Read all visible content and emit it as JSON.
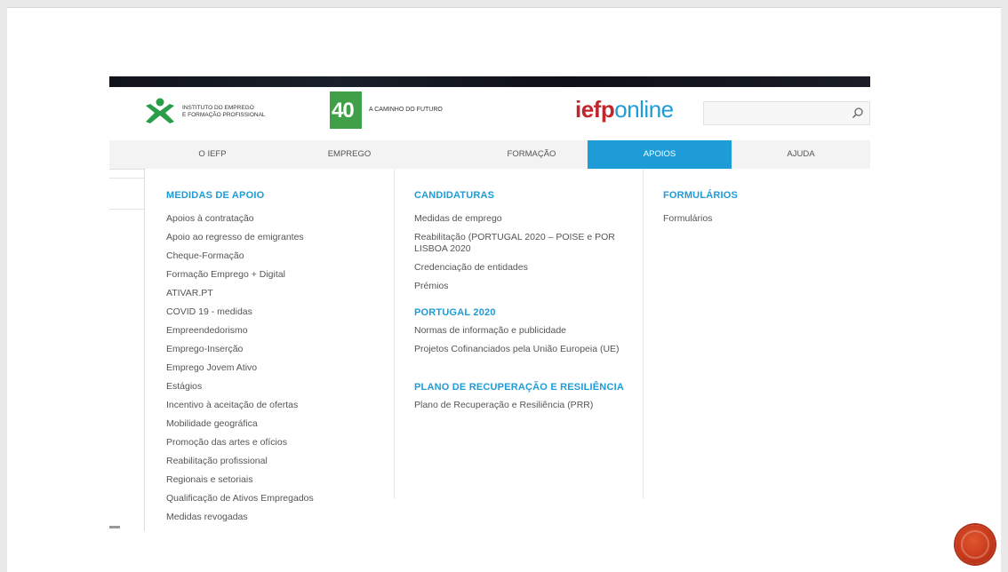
{
  "header": {
    "iefp_logo_text": [
      "INSTITUTO DO EMPREGO",
      "E FORMAÇÃO PROFISSIONAL"
    ],
    "anniversary_logo": "40",
    "tagline": "A CAMINHO DO FUTURO",
    "brand_part1": "iefp",
    "brand_part2": "online",
    "search_placeholder": ""
  },
  "nav": {
    "items": [
      {
        "label": "O IEFP"
      },
      {
        "label": "EMPREGO"
      },
      {
        "label": "FORMAÇÃO"
      },
      {
        "label": "APOIOS",
        "active": true
      },
      {
        "label": "AJUDA"
      }
    ]
  },
  "menu": {
    "col1": {
      "title": "MEDIDAS DE APOIO",
      "links": [
        "Apoios à contratação",
        "Apoio ao regresso de emigrantes",
        "Cheque-Formação",
        "Formação Emprego + Digital",
        "ATIVAR.PT",
        "COVID 19 - medidas",
        "Empreendedorismo",
        "Emprego-Inserção",
        "Emprego Jovem Ativo",
        "Estágios",
        "Incentivo à aceitação de ofertas",
        "Mobilidade geográfica",
        "Promoção das artes e ofícios",
        "Reabilitação profissional",
        "Regionais e setoriais",
        "Qualificação de Ativos Empregados",
        "Medidas revogadas"
      ]
    },
    "col2": {
      "sections": [
        {
          "title": "CANDIDATURAS",
          "links": [
            "Medidas de emprego",
            "Reabilitação (PORTUGAL 2020 – POISE e POR LISBOA 2020",
            "Credenciação de entidades",
            "Prémios"
          ]
        },
        {
          "title": "PORTUGAL 2020",
          "links": [
            "Normas de informação e publicidade",
            "Projetos Cofinanciados pela União Europeia (UE)"
          ]
        },
        {
          "title": "PLANO DE RECUPERAÇÃO E RESILIÊNCIA",
          "links": [
            "Plano de Recuperação e Resiliência (PRR)"
          ]
        }
      ]
    },
    "col3": {
      "title": "FORMULÁRIOS",
      "links": [
        "Formulários"
      ]
    }
  },
  "colors": {
    "accent_blue": "#1e9cd7",
    "brand_red": "#c0272d",
    "logo_green": "#3fa047",
    "slide_button": "#c8391b"
  },
  "icons": [
    "iefp-logo-icon",
    "search-icon",
    "slide-nav-circle-icon"
  ]
}
